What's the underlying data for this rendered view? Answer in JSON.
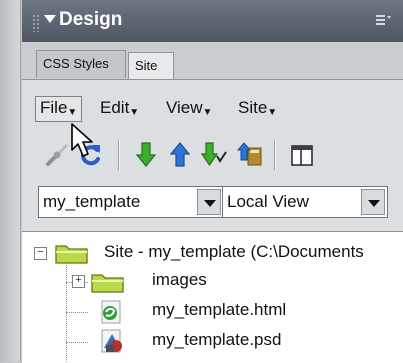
{
  "panel": {
    "title": "Design",
    "tabs": [
      {
        "label": "CSS Styles",
        "active": false
      },
      {
        "label": "Site",
        "active": true
      }
    ]
  },
  "menu": {
    "items": [
      "File",
      "Edit",
      "View",
      "Site"
    ]
  },
  "toolbar": {
    "icons": [
      "connect-icon",
      "refresh-icon",
      "get-files-icon",
      "put-files-icon",
      "check-out-icon",
      "check-in-icon",
      "expand-panel-icon"
    ]
  },
  "selectors": {
    "site": "my_template",
    "view": "Local View"
  },
  "tree": {
    "root": "Site - my_template (C:\\Documents",
    "items": [
      {
        "label": "images",
        "type": "folder",
        "expandable": true
      },
      {
        "label": "my_template.html",
        "type": "html"
      },
      {
        "label": "my_template.psd",
        "type": "psd"
      }
    ]
  },
  "colors": {
    "titlebar": "#5a626e",
    "panel_bg": "#dcdfe2",
    "folder": "#b7d94a",
    "arrow_green": "#3fae2a",
    "arrow_blue": "#2b74d4"
  }
}
